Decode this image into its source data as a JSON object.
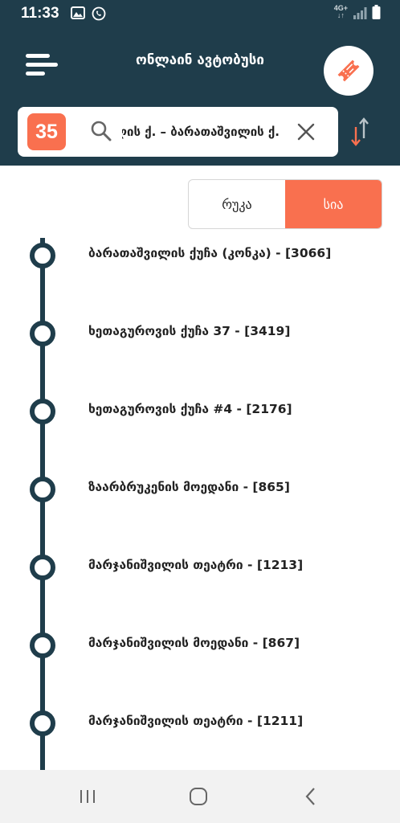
{
  "status": {
    "time": "11:33",
    "network": "4G+",
    "icons": [
      "image-icon",
      "whatsapp-icon",
      "signal-icon",
      "battery-icon"
    ]
  },
  "header": {
    "title": "ონლაინ ავტობუსი",
    "menu_icon": "hamburger-icon",
    "ticket_icon": "ticket-icon"
  },
  "search": {
    "route_number": "35",
    "value": "ბარათაშვილის ქ. – ბარათაშვილის ქ.",
    "clear_icon": "close-icon",
    "swap_icon": "swap-direction-icon"
  },
  "view_toggle": {
    "map_label": "რუკა",
    "list_label": "სია",
    "active": "list"
  },
  "stops": [
    {
      "name": "ბარათაშვილის ქუჩა (კონკა) - [3066]"
    },
    {
      "name": "ხეთაგუროვის ქუჩა 37 - [3419]"
    },
    {
      "name": "ხეთაგუროვის ქუჩა #4 - [2176]"
    },
    {
      "name": "ზაარბრუკენის მოედანი - [865]"
    },
    {
      "name": "მარჯანიშვილის თეატრი - [1213]"
    },
    {
      "name": "მარჯანიშვილის მოედანი - [867]"
    },
    {
      "name": "მარჯანიშვილის თეატრი - [1211]"
    }
  ],
  "colors": {
    "primary": "#1f3d4b",
    "accent": "#f9704f"
  }
}
